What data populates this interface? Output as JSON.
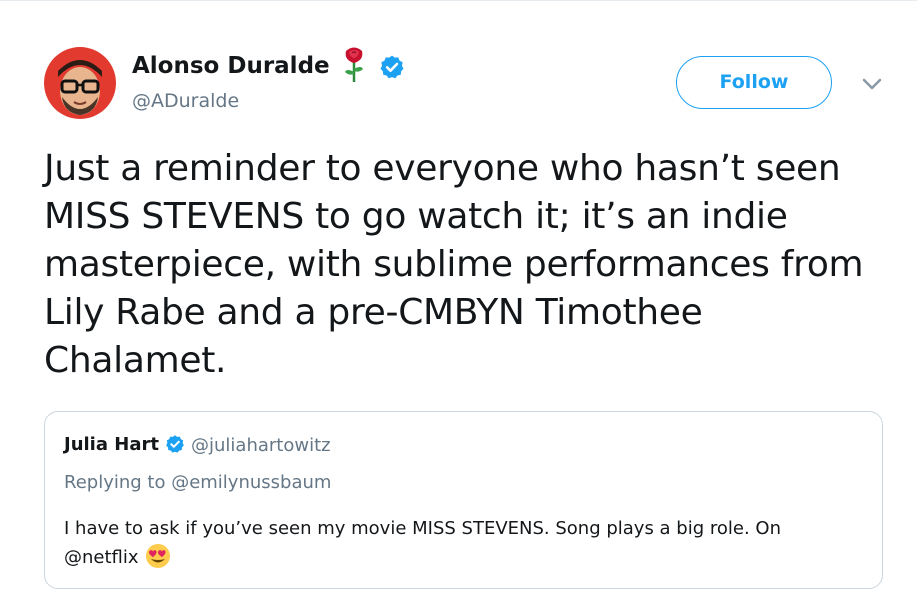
{
  "tweet": {
    "author": {
      "name": "Alonso Duralde",
      "handle": "@ADuralde",
      "name_emoji": "rose-icon",
      "verified": true
    },
    "follow_label": "Follow",
    "text_lines": [
      "Just a reminder to everyone who hasn’t seen",
      "MISS STEVENS to go watch it; it’s an indie",
      "masterpiece, with sublime performances from",
      "Lily Rabe and a pre-CMBYN Timothee",
      "Chalamet."
    ]
  },
  "quoted": {
    "name": "Julia Hart",
    "handle": "@juliahartowitz",
    "verified": true,
    "replying_to": "Replying to @emilynussbaum",
    "text_lines": [
      "I have to ask if you’ve seen my movie MISS STEVENS. Song plays a big role. On",
      "@netflix"
    ],
    "trailing_emoji": "heart-eyes-emoji-icon"
  },
  "colors": {
    "accent": "#1da1f2",
    "text": "#14171a",
    "muted": "#657786",
    "border": "#ccd6dd"
  }
}
